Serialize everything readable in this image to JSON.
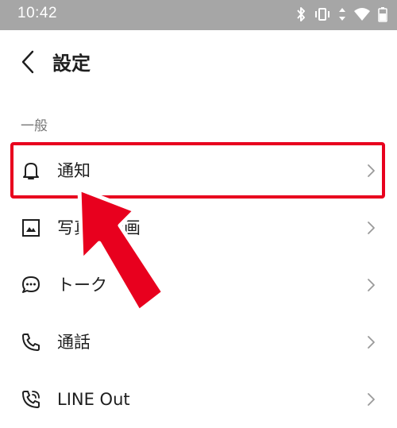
{
  "status_bar": {
    "time": "10:42",
    "icons": [
      "bluetooth-icon",
      "vibrate-icon",
      "data-arrows-icon",
      "wifi-icon",
      "battery-icon"
    ]
  },
  "header": {
    "back_icon": "chevron-left-icon",
    "title": "設定"
  },
  "section": {
    "label": "一般"
  },
  "items": [
    {
      "label": "通知",
      "icon": "bell-icon"
    },
    {
      "label": "写真と動画",
      "icon": "photo-icon"
    },
    {
      "label": "トーク",
      "icon": "chat-bubble-icon"
    },
    {
      "label": "通話",
      "icon": "phone-icon"
    },
    {
      "label": "LINE Out",
      "icon": "phone-out-icon"
    }
  ],
  "annotation": {
    "highlight_color": "#e8001e",
    "highlighted_item": "通知"
  }
}
